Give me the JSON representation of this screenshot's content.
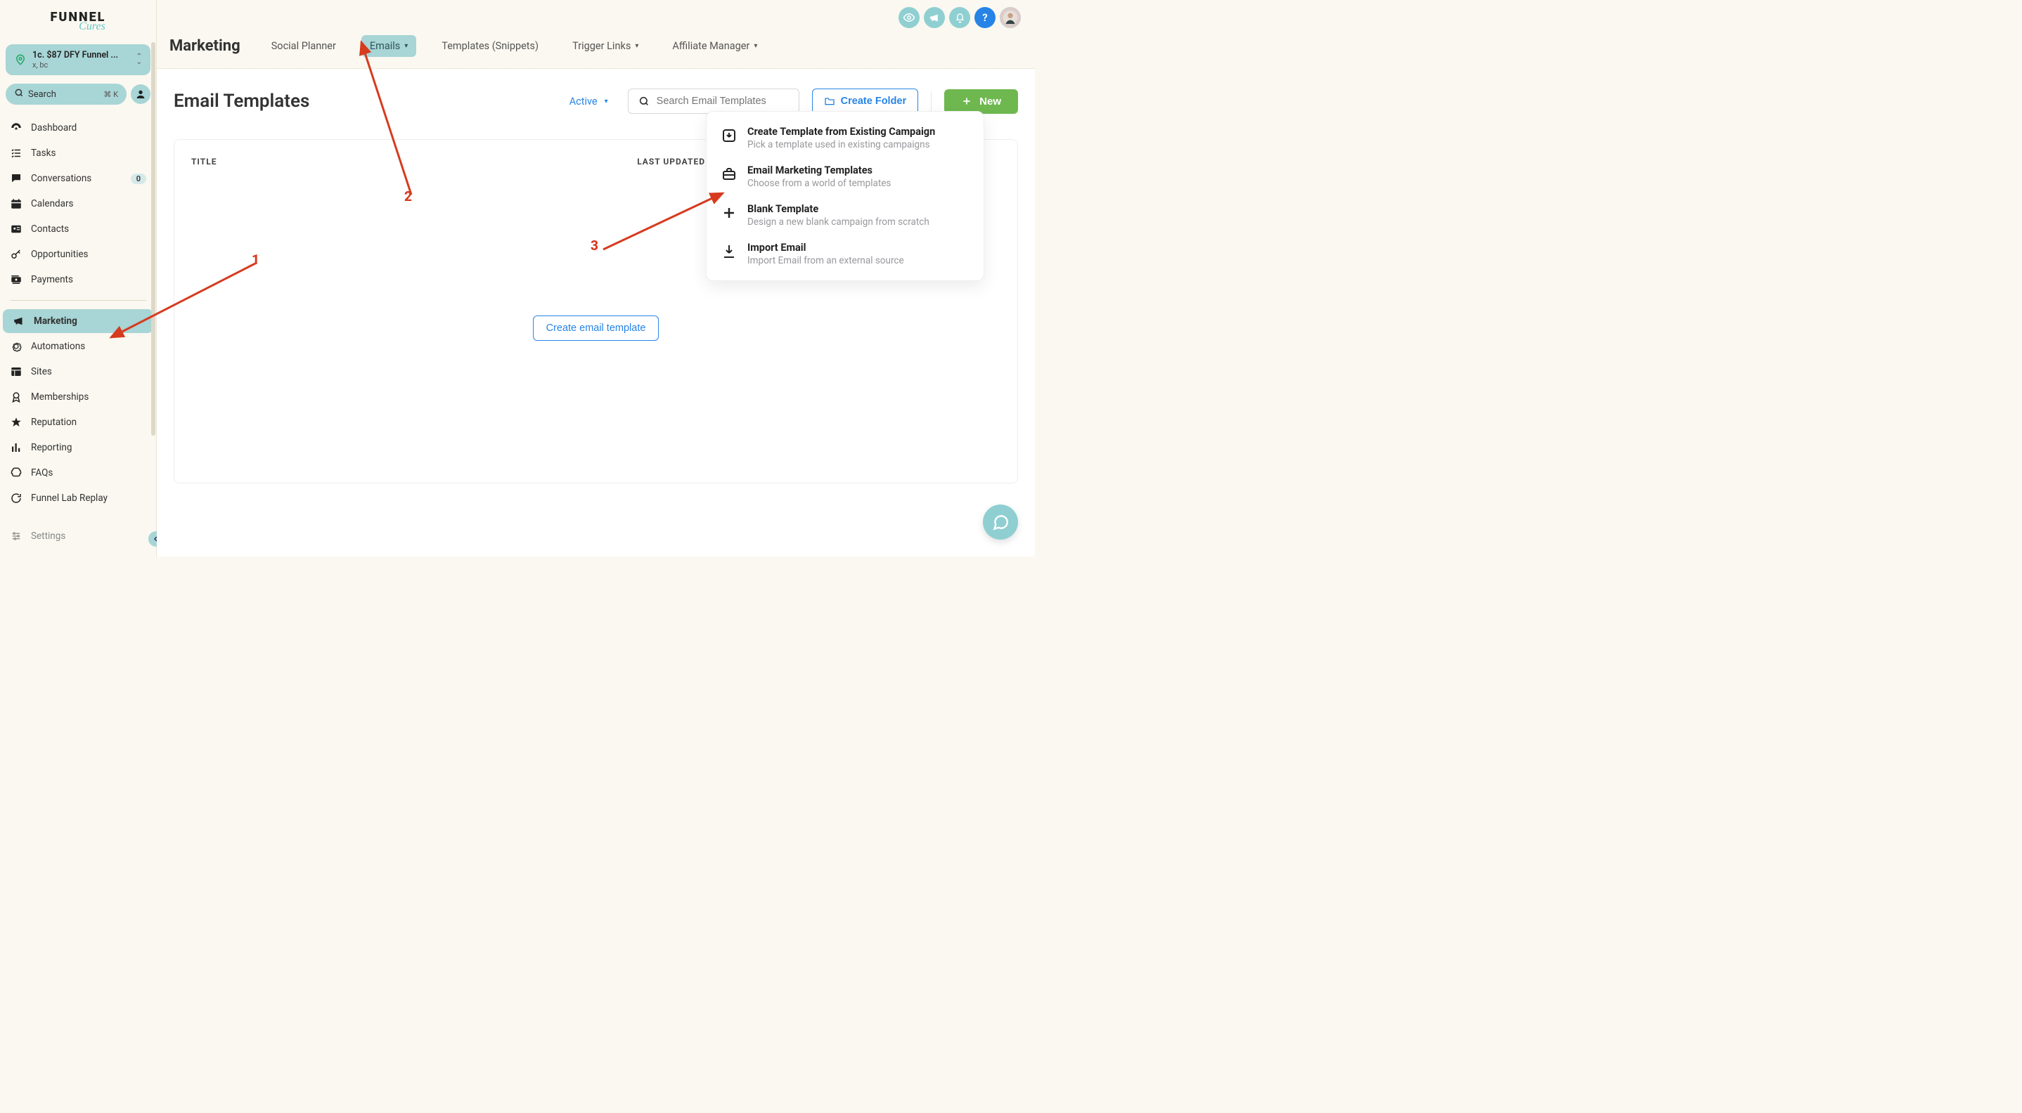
{
  "brand": {
    "main": "FUNNEL",
    "sub": "Cures"
  },
  "account": {
    "line1": "1c. $87 DFY Funnel ...",
    "line2": "x, bc"
  },
  "search": {
    "placeholder": "Search",
    "shortcut": "⌘ K"
  },
  "sidebar": {
    "items": [
      {
        "label": "Dashboard",
        "icon": "gauge"
      },
      {
        "label": "Tasks",
        "icon": "list"
      },
      {
        "label": "Conversations",
        "icon": "chat",
        "badge": "0"
      },
      {
        "label": "Calendars",
        "icon": "calendar"
      },
      {
        "label": "Contacts",
        "icon": "id"
      },
      {
        "label": "Opportunities",
        "icon": "key"
      },
      {
        "label": "Payments",
        "icon": "money"
      }
    ],
    "items2": [
      {
        "label": "Marketing",
        "icon": "mega",
        "active": true
      },
      {
        "label": "Automations",
        "icon": "gear"
      },
      {
        "label": "Sites",
        "icon": "layout"
      },
      {
        "label": "Memberships",
        "icon": "badge"
      },
      {
        "label": "Reputation",
        "icon": "star"
      },
      {
        "label": "Reporting",
        "icon": "bars"
      },
      {
        "label": "FAQs",
        "icon": "brain"
      },
      {
        "label": "Funnel Lab Replay",
        "icon": "reload"
      }
    ],
    "footer": {
      "label": "Settings"
    }
  },
  "topTabs": {
    "heading": "Marketing",
    "items": [
      {
        "label": "Social Planner"
      },
      {
        "label": "Emails",
        "chev": true,
        "active": true
      },
      {
        "label": "Templates (Snippets)"
      },
      {
        "label": "Trigger Links",
        "chev": true
      },
      {
        "label": "Affiliate Manager",
        "chev": true
      }
    ]
  },
  "page": {
    "title": "Email Templates",
    "statusFilter": "Active",
    "searchPlaceholder": "Search Email Templates",
    "createFolder": "Create Folder",
    "newBtn": "New",
    "table": {
      "col1": "TITLE",
      "col2": "LAST UPDATED"
    },
    "emptyCta": "Create email template"
  },
  "dropdown": {
    "items": [
      {
        "title": "Create Template from Existing Campaign",
        "sub": "Pick a template used in existing campaigns",
        "icon": "download-box"
      },
      {
        "title": "Email Marketing Templates",
        "sub": "Choose from a world of templates",
        "icon": "briefcase"
      },
      {
        "title": "Blank Template",
        "sub": "Design a new blank campaign from scratch",
        "icon": "plus"
      },
      {
        "title": "Import Email",
        "sub": "Import Email from an external source",
        "icon": "import"
      }
    ]
  },
  "annotations": {
    "a1": "1",
    "a2": "2",
    "a3": "3"
  },
  "topchips": {
    "help": "?"
  }
}
